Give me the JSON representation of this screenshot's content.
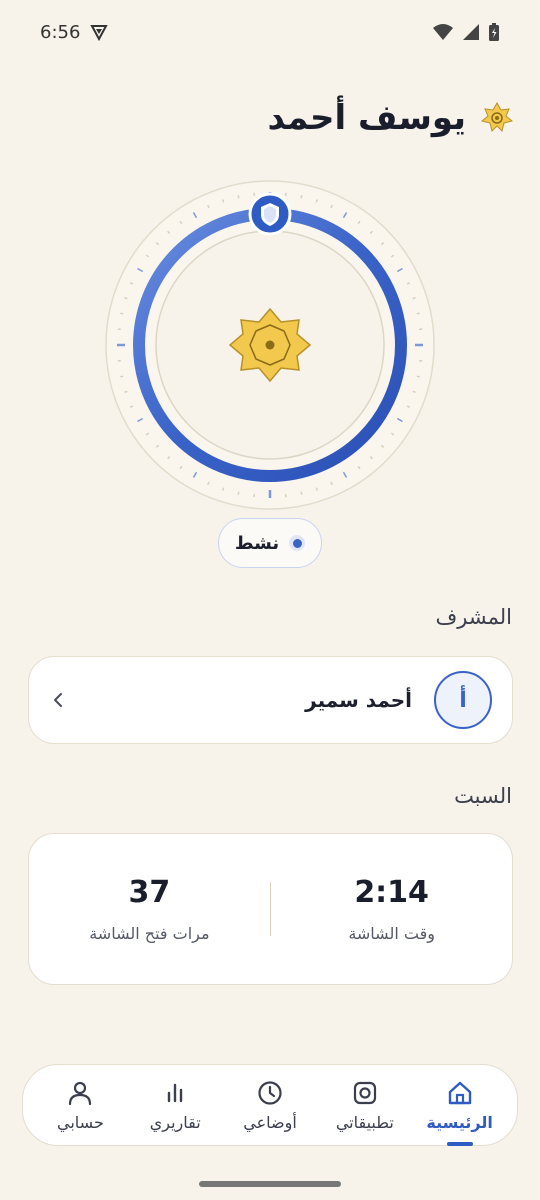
{
  "status_bar": {
    "time": "6:56"
  },
  "header": {
    "child_name": "يوسف أحمد"
  },
  "status": {
    "label": "نشط",
    "active": true
  },
  "supervisor": {
    "section_label": "المشرف",
    "avatar_letter": "أ",
    "name": "أحمد سمير"
  },
  "day": {
    "section_label": "السبت",
    "screen_time_value": "2:14",
    "screen_time_label": "وقت الشاشة",
    "unlocks_value": "37",
    "unlocks_label": "مرات فتح الشاشة"
  },
  "nav": {
    "home": "الرئيسية",
    "apps": "تطبيقاتي",
    "modes": "أوضاعي",
    "reports": "تقاريري",
    "account": "حسابي"
  },
  "colors": {
    "accent": "#2f5bc4",
    "background": "#f7f3ea",
    "star_gold": "#f2c94c"
  }
}
